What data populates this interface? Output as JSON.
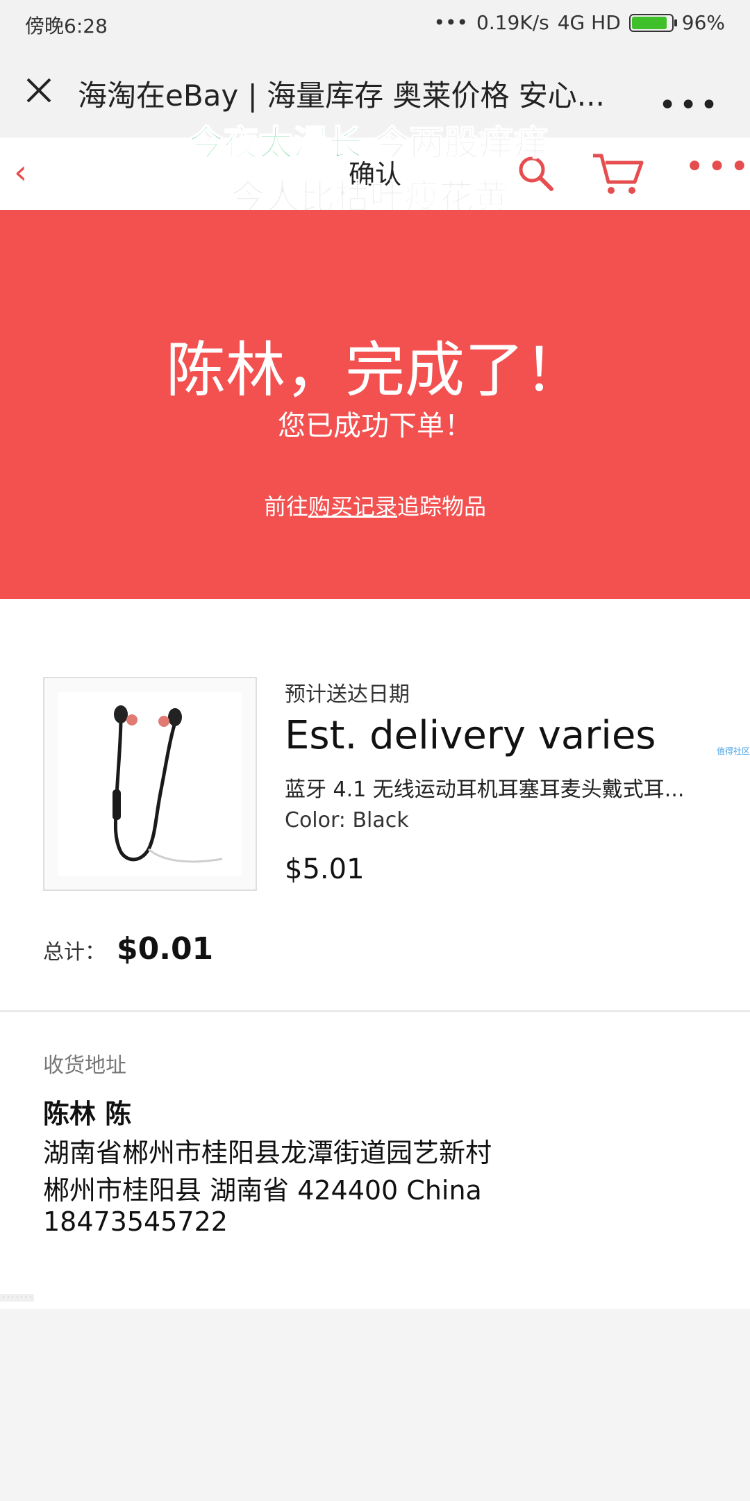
{
  "status_bar": {
    "time": "傍晚6:28",
    "network_speed": "0.19K/s",
    "network_type": "4G HD",
    "battery_percent": "96%",
    "battery_level": 0.96
  },
  "miniapp_bar": {
    "title": "海淘在eBay | 海量库存 奥莱价格 安心..."
  },
  "app_nav": {
    "title": "确认"
  },
  "overlay": {
    "line1_green": "今夜太漫长",
    "line1_rest": "今两股痒痒",
    "line2": "今人比枯叶瘦花黄"
  },
  "hero": {
    "headline": "陈林，完成了！",
    "subtitle": "您已成功下单！",
    "track_prefix": "前往",
    "track_link": "购买记录",
    "track_suffix": "追踪物品"
  },
  "order": {
    "eta_label": "预计送达日期",
    "eta_value": "Est. delivery varies",
    "item_title": "蓝牙 4.1 无线运动耳机耳塞耳麦头戴式耳...",
    "item_variant": "Color: Black",
    "item_price": "$5.01",
    "total_label": "总计：",
    "total_value": "$0.01",
    "side_note": "值得社区"
  },
  "address": {
    "label": "收货地址",
    "name": "陈林 陈",
    "line1": "湖南省郴州市桂阳县龙潭街道园艺新村",
    "line2": "郴州市桂阳县 湖南省 424400 China",
    "phone": "18473545722"
  },
  "colors": {
    "accent": "#f35050",
    "nav_red": "#e54d4f",
    "overlay_green": "#2cc46a"
  },
  "icons": [
    "close-icon",
    "more-icon",
    "back-icon",
    "search-icon",
    "cart-icon",
    "menu-icon",
    "battery-icon"
  ]
}
